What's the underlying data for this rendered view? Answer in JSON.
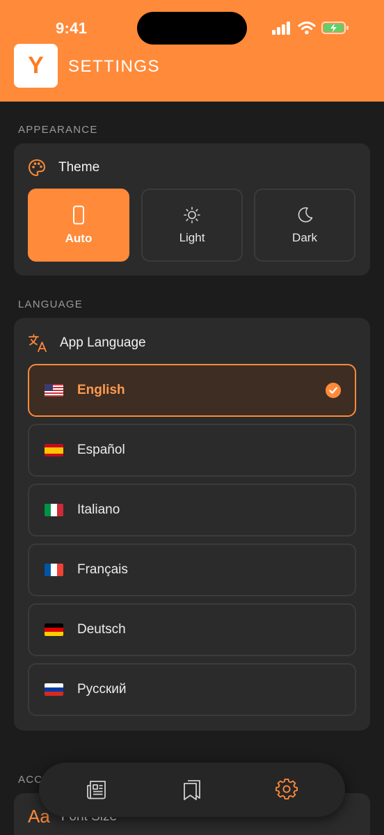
{
  "status_bar": {
    "time": "9:41"
  },
  "header": {
    "logo_letter": "Y",
    "title": "SETTINGS"
  },
  "appearance": {
    "section_label": "APPEARANCE",
    "theme_title": "Theme",
    "options": [
      {
        "label": "Auto",
        "icon": "phone-icon",
        "selected": true
      },
      {
        "label": "Light",
        "icon": "sun-icon",
        "selected": false
      },
      {
        "label": "Dark",
        "icon": "moon-icon",
        "selected": false
      }
    ]
  },
  "language": {
    "section_label": "LANGUAGE",
    "title": "App Language",
    "options": [
      {
        "label": "English",
        "flag": "us-flag-icon",
        "selected": true
      },
      {
        "label": "Español",
        "flag": "es-flag-icon",
        "selected": false
      },
      {
        "label": "Italiano",
        "flag": "it-flag-icon",
        "selected": false
      },
      {
        "label": "Français",
        "flag": "fr-flag-icon",
        "selected": false
      },
      {
        "label": "Deutsch",
        "flag": "de-flag-icon",
        "selected": false
      },
      {
        "label": "Русский",
        "flag": "ru-flag-icon",
        "selected": false
      }
    ]
  },
  "accessibility": {
    "section_label": "ACC",
    "font_size_icon": "Aa",
    "font_size_label": "Font Size"
  },
  "tabbar": {
    "items": [
      {
        "icon": "news-icon",
        "active": false
      },
      {
        "icon": "bookmark-icon",
        "active": false
      },
      {
        "icon": "gear-icon",
        "active": true
      }
    ]
  },
  "colors": {
    "accent": "#ff8a3a",
    "background": "#1c1c1c",
    "card": "#2b2b2b",
    "border": "#3b3b3b"
  }
}
